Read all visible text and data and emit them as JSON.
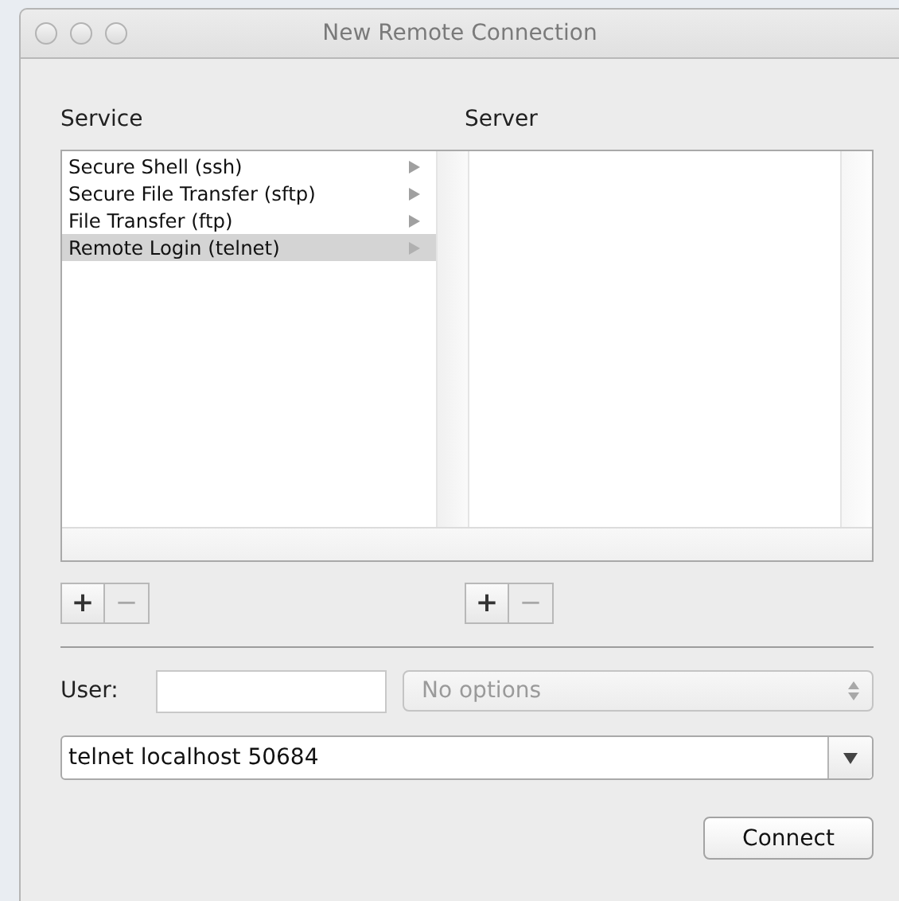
{
  "window": {
    "title": "New Remote Connection"
  },
  "service": {
    "heading": "Service",
    "items": [
      {
        "label": "Secure Shell (ssh)",
        "selected": false
      },
      {
        "label": "Secure File Transfer (sftp)",
        "selected": false
      },
      {
        "label": "File Transfer (ftp)",
        "selected": false
      },
      {
        "label": "Remote Login (telnet)",
        "selected": true
      }
    ],
    "buttons": [
      {
        "label": "+",
        "disabled": false
      },
      {
        "label": "−",
        "disabled": true
      }
    ]
  },
  "server": {
    "heading": "Server",
    "buttons": [
      {
        "label": "+",
        "disabled": false
      },
      {
        "label": "−",
        "disabled": true
      }
    ]
  },
  "user": {
    "label": "User:"
  },
  "options": {
    "value": "No options",
    "disabled": true
  },
  "command": {
    "value": "telnet localhost 50684"
  },
  "connect_button": {
    "label": "Connect"
  }
}
